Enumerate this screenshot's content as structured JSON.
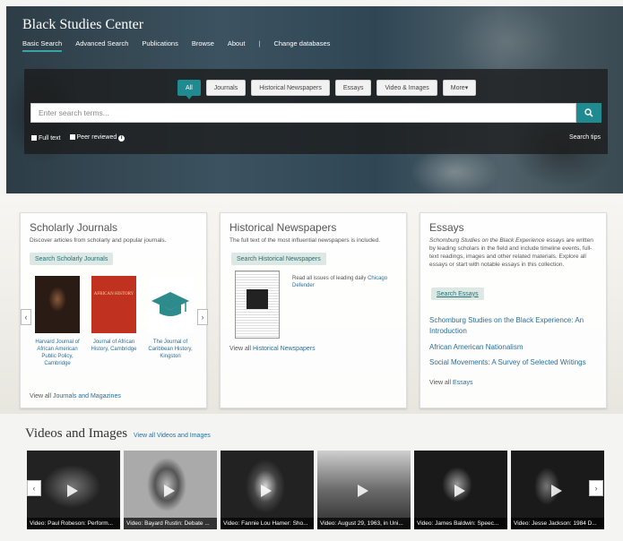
{
  "header": {
    "brand": "Black Studies Center",
    "nav": [
      "Basic Search",
      "Advanced Search",
      "Publications",
      "Browse",
      "About",
      "|",
      "Change databases"
    ]
  },
  "search": {
    "tabs": [
      "All",
      "Journals",
      "Historical Newspapers",
      "Essays",
      "Video & Images",
      "More"
    ],
    "more_caret": "▾",
    "placeholder": "Enter search terms...",
    "filters": {
      "full_text": "Full text",
      "peer_reviewed": "Peer reviewed",
      "info": "i"
    },
    "tips": "Search tips"
  },
  "journals": {
    "title": "Scholarly Journals",
    "desc": "Discover articles from scholarly and popular journals.",
    "button": "Search Scholarly Journals",
    "items": [
      {
        "title": "Harvard Journal of African American Public Policy, Cambridge"
      },
      {
        "title": "Journal of African History, Cambridge",
        "cover_text": "AFRICAN HISTORY"
      },
      {
        "title": "The Journal of Caribbean History, Kingston"
      }
    ],
    "view_all_prefix": "View all",
    "view_all_link": "Journals and Magazines"
  },
  "newspapers": {
    "title": "Historical Newspapers",
    "desc": "The full text of the most influential newspapers is included.",
    "button": "Search Historical Newspapers",
    "read_prefix": "Read all issues of leading daily",
    "read_link": "Chicago Defender",
    "view_all_prefix": "View all",
    "view_all_link": "Historical Newspapers"
  },
  "essays": {
    "title": "Essays",
    "desc_italic": "Schomburg Studies on the Black Experience",
    "desc_rest": "essays are written by leading scholars in the field and include timeline events, full-text readings, images and other related materials. Explore all essays or start with notable essays in this collection.",
    "button": "Search Essays",
    "links": [
      "Schomburg Studies on the Black Experience: An Introduction",
      "African American Nationalism",
      "Social Movements: A Survey of Selected Writings"
    ],
    "view_all_prefix": "View all",
    "view_all_link": "Essays"
  },
  "videos": {
    "title": "Videos and Images",
    "view_all": "View all Videos and Images",
    "items": [
      "Video: Paul Robeson: Perform...",
      "Video: Bayard Rustin: Debate ...",
      "Video: Fannie Lou Hamer: Sho...",
      "Video: August 29, 1963, in Uni...",
      "Video: James Baldwin: Speec...",
      "Video: Jesse Jackson: 1984 D..."
    ]
  },
  "icons": {
    "prev": "‹",
    "next": "›",
    "search": "search-icon"
  }
}
